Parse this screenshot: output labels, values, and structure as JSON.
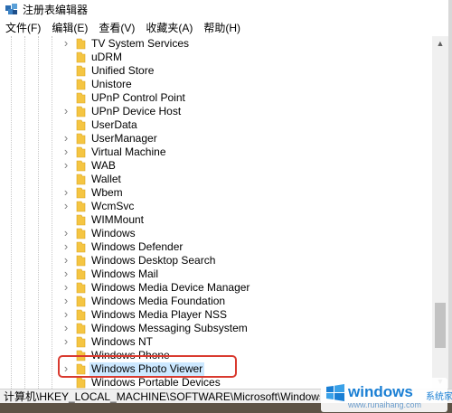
{
  "window": {
    "title": "注册表编辑器"
  },
  "menu": [
    "文件(F)",
    "编辑(E)",
    "查看(V)",
    "收藏夹(A)",
    "帮助(H)"
  ],
  "tree": {
    "items": [
      {
        "label": "TV System Services",
        "expandable": true
      },
      {
        "label": "uDRM",
        "expandable": false
      },
      {
        "label": "Unified Store",
        "expandable": false
      },
      {
        "label": "Unistore",
        "expandable": false
      },
      {
        "label": "UPnP Control Point",
        "expandable": false
      },
      {
        "label": "UPnP Device Host",
        "expandable": true
      },
      {
        "label": "UserData",
        "expandable": false
      },
      {
        "label": "UserManager",
        "expandable": true
      },
      {
        "label": "Virtual Machine",
        "expandable": true
      },
      {
        "label": "WAB",
        "expandable": true
      },
      {
        "label": "Wallet",
        "expandable": false
      },
      {
        "label": "Wbem",
        "expandable": true
      },
      {
        "label": "WcmSvc",
        "expandable": true
      },
      {
        "label": "WIMMount",
        "expandable": false
      },
      {
        "label": "Windows",
        "expandable": true
      },
      {
        "label": "Windows Defender",
        "expandable": true
      },
      {
        "label": "Windows Desktop Search",
        "expandable": true
      },
      {
        "label": "Windows Mail",
        "expandable": true
      },
      {
        "label": "Windows Media Device Manager",
        "expandable": true
      },
      {
        "label": "Windows Media Foundation",
        "expandable": true
      },
      {
        "label": "Windows Media Player NSS",
        "expandable": true
      },
      {
        "label": "Windows Messaging Subsystem",
        "expandable": true
      },
      {
        "label": "Windows NT",
        "expandable": true
      },
      {
        "label": "Windows Phone",
        "expandable": false
      },
      {
        "label": "Windows Photo Viewer",
        "expandable": true,
        "selected": true
      },
      {
        "label": "Windows Portable Devices",
        "expandable": false
      }
    ]
  },
  "status": {
    "path": "计算机\\HKEY_LOCAL_MACHINE\\SOFTWARE\\Microsoft\\Windows Photo Viewer"
  },
  "watermark": {
    "brand": "windows",
    "cn": "系统家园",
    "url": "www.runaihang.com"
  },
  "colors": {
    "selection": "#cce8ff",
    "highlight_border": "#d93a2f",
    "folder": "#f5c542"
  }
}
